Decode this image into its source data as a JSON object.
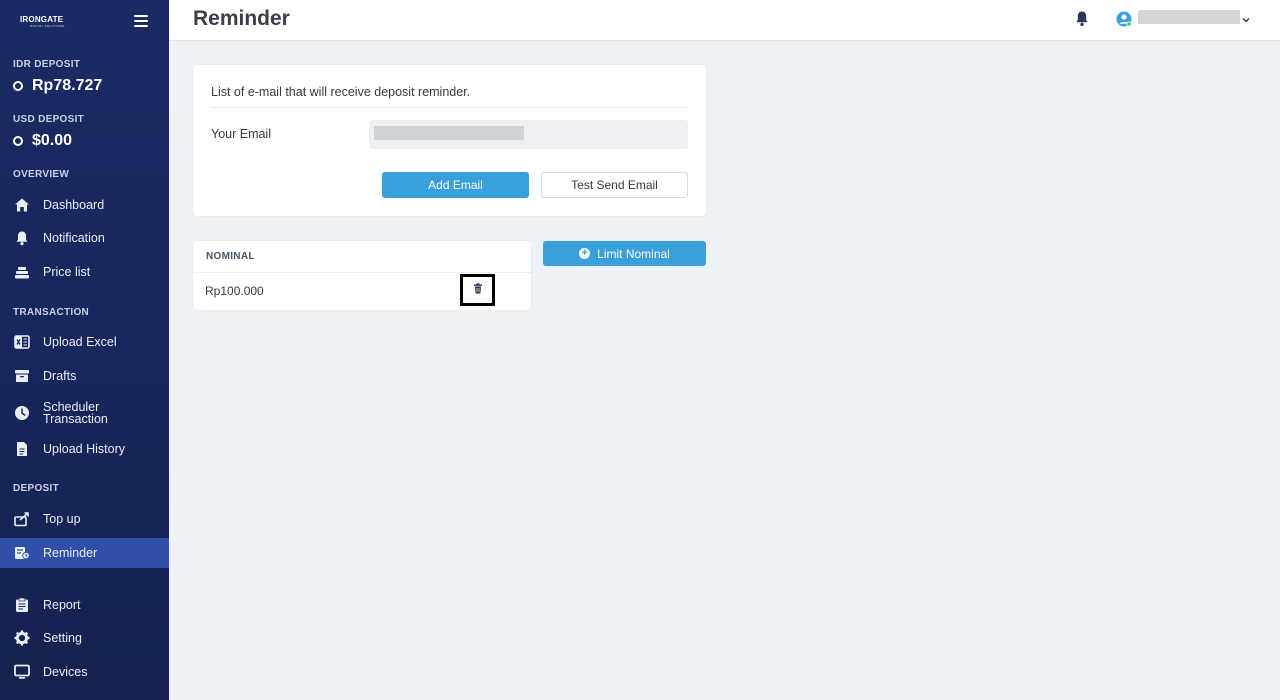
{
  "app": {
    "logo_text": "IRONGATE",
    "logo_subtext": "DIGITAL SOLUTIONS",
    "page_title": "Reminder"
  },
  "sidebar": {
    "idr_deposit_label": "IDR DEPOSIT",
    "idr_deposit_value": "Rp78.727",
    "usd_deposit_label": "USD DEPOSIT",
    "usd_deposit_value": "$0.00",
    "sections": {
      "overview": "OVERVIEW",
      "transaction": "TRANSACTION",
      "deposit": "DEPOSIT"
    },
    "items": {
      "dashboard": {
        "label": "Dashboard",
        "icon": "home-icon"
      },
      "notification": {
        "label": "Notification",
        "icon": "bell-icon"
      },
      "price_list": {
        "label": "Price list",
        "icon": "stack-icon"
      },
      "upload_excel": {
        "label": "Upload Excel",
        "icon": "excel-icon"
      },
      "drafts": {
        "label": "Drafts",
        "icon": "archive-icon"
      },
      "scheduler_line1": {
        "label": "Scheduler",
        "icon": "clock-icon"
      },
      "scheduler_line2": {
        "label": "Transaction"
      },
      "upload_history": {
        "label": "Upload History",
        "icon": "file-icon"
      },
      "top_up": {
        "label": "Top up",
        "icon": "wallet-icon"
      },
      "reminder": {
        "label": "Reminder",
        "icon": "reminder-icon",
        "active": true
      },
      "report": {
        "label": "Report",
        "icon": "clipboard-icon"
      },
      "setting": {
        "label": "Setting",
        "icon": "gear-icon"
      },
      "devices": {
        "label": "Devices",
        "icon": "monitor-icon"
      }
    }
  },
  "email_card": {
    "description": "List of e-mail that will receive deposit reminder.",
    "email_label": "Your Email",
    "email_value": "",
    "add_button": "Add Email",
    "test_button": "Test Send Email"
  },
  "nominal_table": {
    "header": "NOMINAL",
    "rows": [
      {
        "value": "Rp100.000"
      }
    ]
  },
  "limit_button": "Limit Nominal",
  "colors": {
    "sidebar_bg": "#1a2a63",
    "sidebar_active": "#2f4fa8",
    "accent": "#3aa0dc",
    "page_bg": "#eef1f6"
  }
}
